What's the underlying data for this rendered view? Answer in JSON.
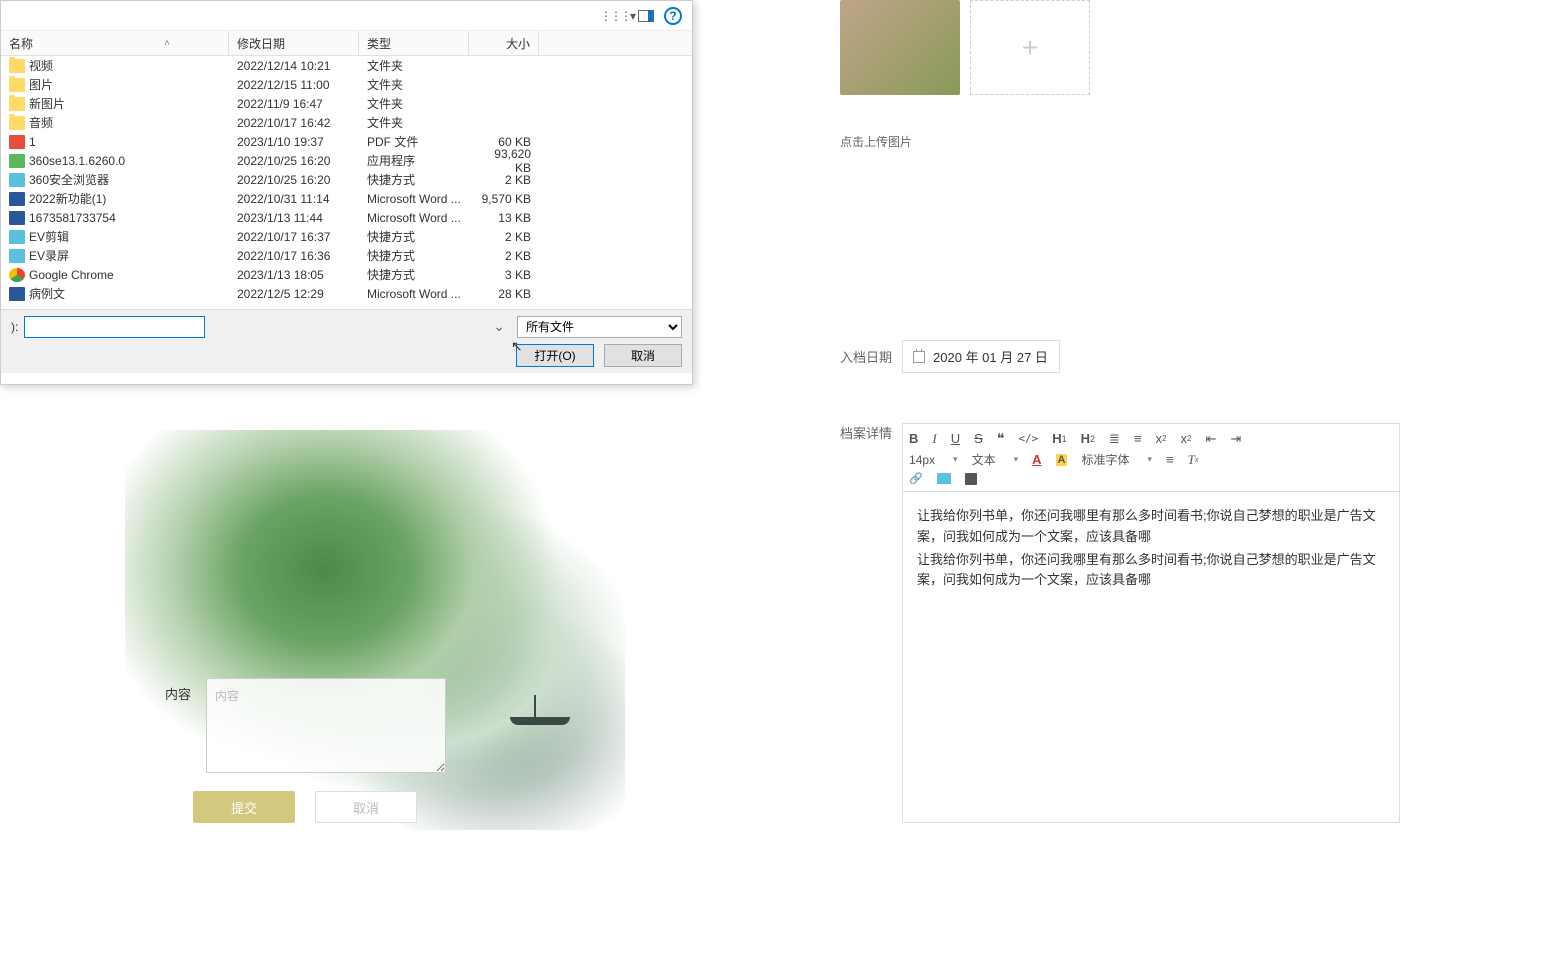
{
  "fileDialog": {
    "columns": {
      "name": "名称",
      "date": "修改日期",
      "type": "类型",
      "size": "大小"
    },
    "files": [
      {
        "icon": "folder",
        "name": "视频",
        "date": "2022/12/14 10:21",
        "type": "文件夹",
        "size": ""
      },
      {
        "icon": "folder",
        "name": "图片",
        "date": "2022/12/15 11:00",
        "type": "文件夹",
        "size": ""
      },
      {
        "icon": "folder",
        "name": "新图片",
        "date": "2022/11/9 16:47",
        "type": "文件夹",
        "size": ""
      },
      {
        "icon": "folder",
        "name": "音频",
        "date": "2022/10/17 16:42",
        "type": "文件夹",
        "size": ""
      },
      {
        "icon": "pdf",
        "name": "1",
        "date": "2023/1/10 19:37",
        "type": "PDF 文件",
        "size": "60 KB"
      },
      {
        "icon": "exe",
        "name": "360se13.1.6260.0",
        "date": "2022/10/25 16:20",
        "type": "应用程序",
        "size": "93,620 KB"
      },
      {
        "icon": "lnk",
        "name": "360安全浏览器",
        "date": "2022/10/25 16:20",
        "type": "快捷方式",
        "size": "2 KB"
      },
      {
        "icon": "doc",
        "name": "2022新功能(1)",
        "date": "2022/10/31 11:14",
        "type": "Microsoft Word ...",
        "size": "9,570 KB"
      },
      {
        "icon": "doc",
        "name": "1673581733754",
        "date": "2023/1/13 11:44",
        "type": "Microsoft Word ...",
        "size": "13 KB"
      },
      {
        "icon": "lnk",
        "name": "EV剪辑",
        "date": "2022/10/17 16:37",
        "type": "快捷方式",
        "size": "2 KB"
      },
      {
        "icon": "lnk",
        "name": "EV录屏",
        "date": "2022/10/17 16:36",
        "type": "快捷方式",
        "size": "2 KB"
      },
      {
        "icon": "chrome",
        "name": "Google Chrome",
        "date": "2023/1/13 18:05",
        "type": "快捷方式",
        "size": "3 KB"
      },
      {
        "icon": "doc",
        "name": "病例文",
        "date": "2022/12/5 12:29",
        "type": "Microsoft Word ...",
        "size": "28 KB"
      }
    ],
    "filenameLabel": "):",
    "filetypeValue": "所有文件",
    "openBtn": "打开(O)",
    "cancelBtn": "取消"
  },
  "rightForm": {
    "uploadHint": "点击上传图片",
    "dateLabel": "入档日期",
    "dateValue": "2020 年 01 月 27 日",
    "detailsLabel": "档案详情",
    "toolbar": {
      "fontSize": "14px",
      "textType": "文本",
      "fontFamily": "标准字体"
    },
    "content": {
      "p1": "让我给你列书单，你还问我哪里有那么多时间看书;你说自己梦想的职业是广告文案，问我如何成为一个文案，应该具备哪",
      "p2": "让我给你列书单，你还问我哪里有那么多时间看书;你说自己梦想的职业是广告文案，问我如何成为一个文案，应该具备哪"
    }
  },
  "bottomForm": {
    "contentLabel": "内容",
    "contentPlaceholder": "内容",
    "submitBtn": "提交",
    "cancelBtn": "取消"
  }
}
